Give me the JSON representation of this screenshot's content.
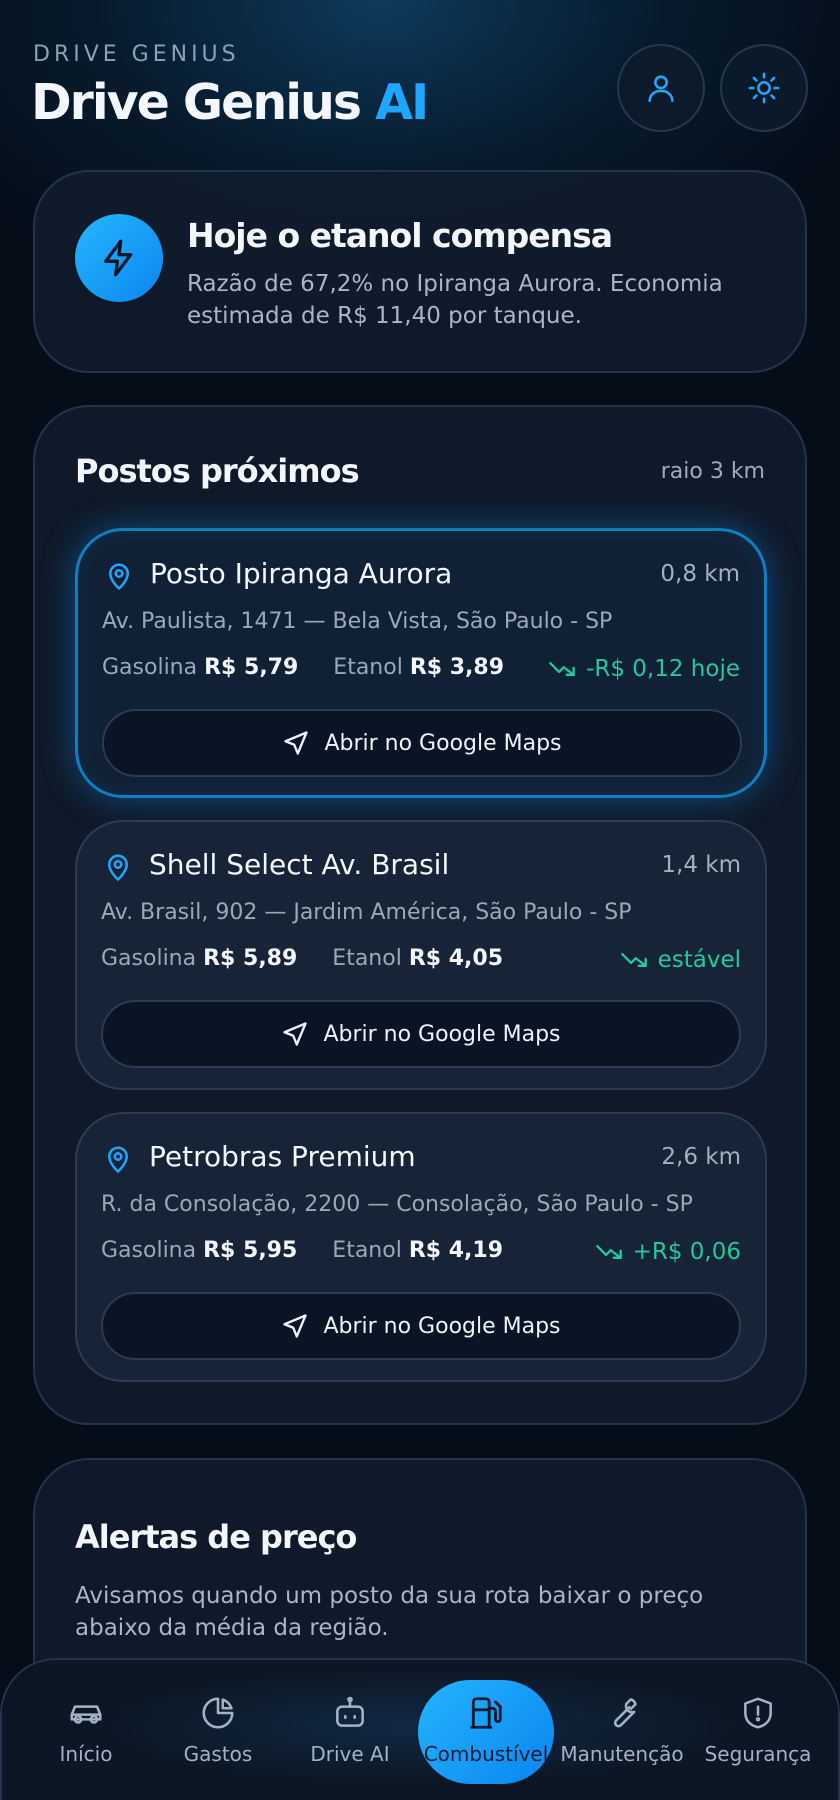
{
  "header": {
    "eyebrow": "DRIVE GENIUS",
    "title_main": "Drive Genius",
    "title_accent": "AI",
    "profile_icon": "user-icon",
    "theme_icon": "sun-icon"
  },
  "insight": {
    "icon": "lightning-icon",
    "title": "Hoje o etanol compensa",
    "description": "Razão de 67,2% no Ipiranga Aurora. Economia estimada de R$ 11,40 por tanque."
  },
  "stations": {
    "title": "Postos próximos",
    "radius": "raio 3 km",
    "gas_label": "Gasolina",
    "ethanol_label": "Etanol",
    "maps_label": "Abrir no Google Maps",
    "items": [
      {
        "name": "Posto Ipiranga Aurora",
        "distance": "0,8 km",
        "address": "Av. Paulista, 1471 — Bela Vista, São Paulo - SP",
        "gas_price": "R$ 5,79",
        "ethanol_price": "R$ 3,89",
        "trend": "-R$ 0,12 hoje",
        "active": true
      },
      {
        "name": "Shell Select Av. Brasil",
        "distance": "1,4 km",
        "address": "Av. Brasil, 902 — Jardim América, São Paulo - SP",
        "gas_price": "R$ 5,89",
        "ethanol_price": "R$ 4,05",
        "trend": "estável",
        "active": false
      },
      {
        "name": "Petrobras Premium",
        "distance": "2,6 km",
        "address": "R. da Consolação, 2200 — Consolação, São Paulo - SP",
        "gas_price": "R$ 5,95",
        "ethanol_price": "R$ 4,19",
        "trend": "+R$ 0,06",
        "active": false
      }
    ]
  },
  "alerts": {
    "title": "Alertas de preço",
    "description": "Avisamos quando um posto da sua rota baixar o preço abaixo da média da região."
  },
  "nav": {
    "items": [
      {
        "label": "Início",
        "icon": "car-icon",
        "active": false
      },
      {
        "label": "Gastos",
        "icon": "pie-chart-icon",
        "active": false
      },
      {
        "label": "Drive AI",
        "icon": "robot-icon",
        "active": false
      },
      {
        "label": "Combustível",
        "icon": "fuel-pump-icon",
        "active": true
      },
      {
        "label": "Manutenção",
        "icon": "wrench-icon",
        "active": false
      },
      {
        "label": "Segurança",
        "icon": "shield-icon",
        "active": false
      }
    ]
  },
  "colors": {
    "accent": "#1ea7ff",
    "trend_green": "#22c99a",
    "background": "#050d19"
  }
}
